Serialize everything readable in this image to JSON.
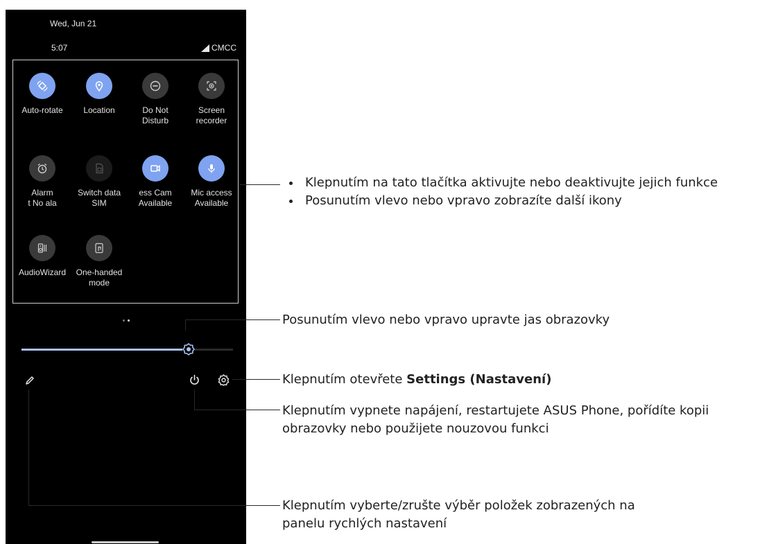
{
  "status": {
    "date": "Wed, Jun 21",
    "time": "5:07",
    "carrier": "CMCC"
  },
  "tiles": [
    {
      "label": "Auto-rotate",
      "icon": "auto-rotate-icon",
      "state": "on"
    },
    {
      "label": "Location",
      "icon": "location-icon",
      "state": "on"
    },
    {
      "label": "Do Not\nDisturb",
      "icon": "do-not-disturb-icon",
      "state": "off"
    },
    {
      "label": "Screen\nrecorder",
      "icon": "screen-recorder-icon",
      "state": "off"
    },
    {
      "label": "Alarm\nt    No ala",
      "icon": "alarm-icon",
      "state": "off"
    },
    {
      "label": "Switch data\nSIM",
      "icon": "sim-icon",
      "state": "dim"
    },
    {
      "label": "ess    Cam\nAvailable",
      "icon": "camera-icon",
      "state": "on"
    },
    {
      "label": "Mic access\nAvailable",
      "icon": "microphone-icon",
      "state": "on"
    },
    {
      "label": "AudioWizard",
      "icon": "audiowizard-icon",
      "state": "off"
    },
    {
      "label": "One-handed\nmode",
      "icon": "one-handed-icon",
      "state": "off"
    }
  ],
  "brightness": {
    "level": 0.79
  },
  "pager": {
    "pages": 2,
    "current": 2
  },
  "annotations": {
    "tiles_bullets": [
      "Klepnutím na tato tlačítka aktivujte nebo deaktivujte jejich funkce",
      "Posunutím vlevo nebo vpravo zobrazíte další ikony"
    ],
    "brightness": "Posunutím vlevo nebo vpravo upravte jas obrazovky",
    "settings_prefix": "Klepnutím otevřete ",
    "settings_bold": "Settings (Nastavení)",
    "power_line1": "Klepnutím vypnete napájení, restartujete ASUS Phone, pořídíte kopii",
    "power_line2": "obrazovky nebo použijete nouzovou funkci",
    "edit_line1": "Klepnutím vyberte/zrušte výběr položek zobrazených na",
    "edit_line2": "panelu rychlých nastavení"
  },
  "colors": {
    "tile_on": "#7fa3f0",
    "tile_off": "#3a3a3a",
    "phone_bg": "#000000"
  }
}
